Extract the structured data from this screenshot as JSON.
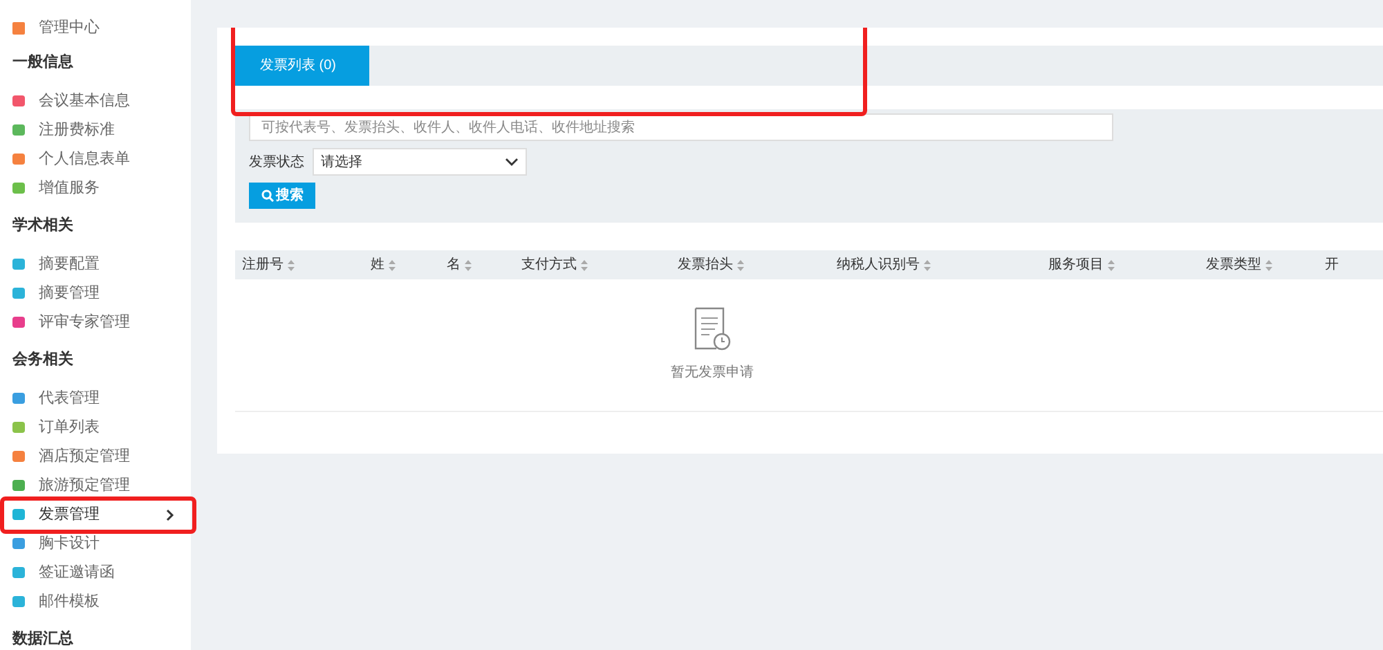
{
  "sidebar": {
    "top": {
      "label": "管理中心",
      "color": "#f5813f"
    },
    "sections": [
      {
        "title": "一般信息",
        "items": [
          {
            "label": "会议基本信息",
            "color": "#f2566b",
            "selected": false
          },
          {
            "label": "注册费标准",
            "color": "#5cb85c",
            "selected": false
          },
          {
            "label": "个人信息表单",
            "color": "#f5813f",
            "selected": false
          },
          {
            "label": "增值服务",
            "color": "#6cbf4a",
            "selected": false
          }
        ]
      },
      {
        "title": "学术相关",
        "items": [
          {
            "label": "摘要配置",
            "color": "#2bb3d9",
            "selected": false
          },
          {
            "label": "摘要管理",
            "color": "#2bb3d9",
            "selected": false
          },
          {
            "label": "评审专家管理",
            "color": "#e83e8c",
            "selected": false
          }
        ]
      },
      {
        "title": "会务相关",
        "items": [
          {
            "label": "代表管理",
            "color": "#3a9ee0",
            "selected": false
          },
          {
            "label": "订单列表",
            "color": "#8bc34a",
            "selected": false
          },
          {
            "label": "酒店预定管理",
            "color": "#f5813f",
            "selected": false
          },
          {
            "label": "旅游预定管理",
            "color": "#4caf50",
            "selected": false
          },
          {
            "label": "发票管理",
            "color": "#1fb5d6",
            "selected": true
          },
          {
            "label": "胸卡设计",
            "color": "#3a9ee0",
            "selected": false
          },
          {
            "label": "签证邀请函",
            "color": "#2bb3d9",
            "selected": false
          },
          {
            "label": "邮件模板",
            "color": "#2bb3d9",
            "selected": false
          }
        ]
      },
      {
        "title": "数据汇总"
      }
    ]
  },
  "tabs": [
    {
      "label": "发票列表 (0)",
      "selected": true
    }
  ],
  "search": {
    "placeholder": "可按代表号、发票抬头、收件人、收件人电话、收件地址搜索"
  },
  "status_filter": {
    "label": "发票状态",
    "value": "请选择"
  },
  "search_button": "搜索",
  "table": {
    "columns": [
      "注册号",
      "姓",
      "名",
      "支付方式",
      "发票抬头",
      "纳税人识别号",
      "服务项目",
      "发票类型",
      "开"
    ],
    "empty_text": "暂无发票申请"
  }
}
